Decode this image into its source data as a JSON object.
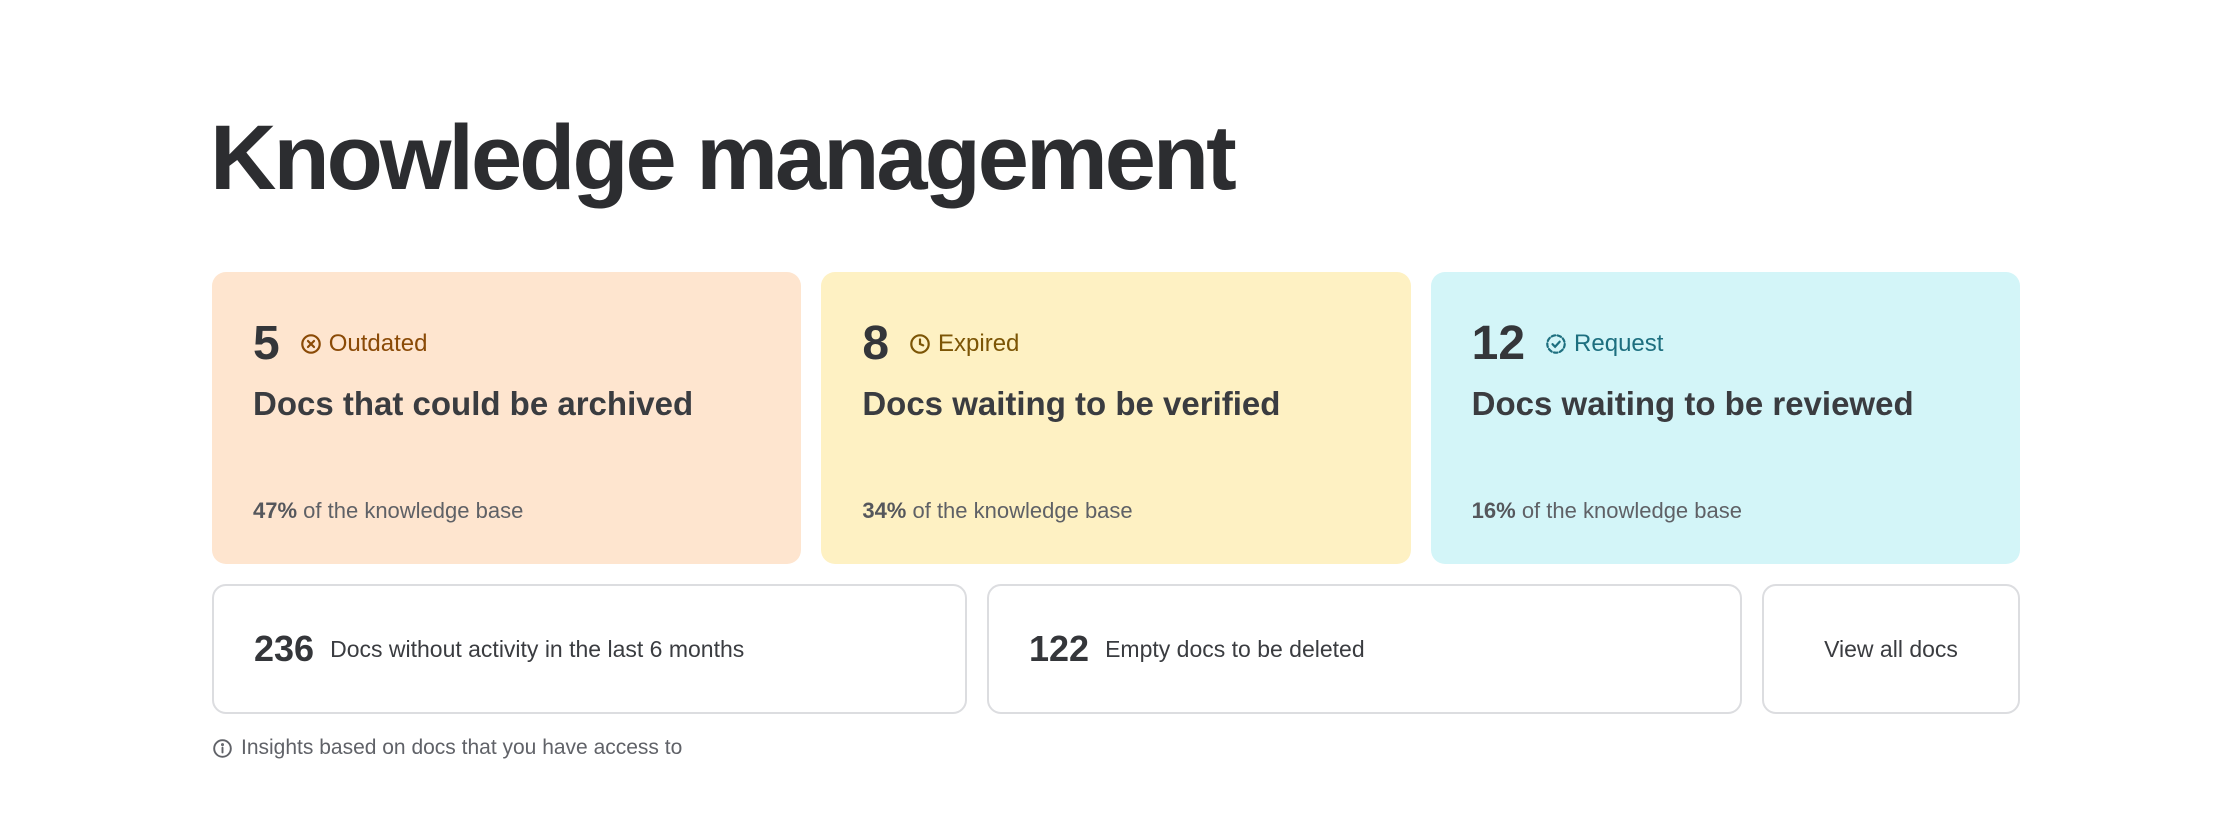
{
  "page": {
    "title": "Knowledge management"
  },
  "stats": [
    {
      "count": "5",
      "status": "Outdated",
      "icon": "x-circle-icon",
      "description": "Docs that could be archived",
      "percent": "47%",
      "percent_suffix": " of the knowledge base",
      "color": "#fee5cf"
    },
    {
      "count": "8",
      "status": "Expired",
      "icon": "clock-icon",
      "description": "Docs waiting to be verified",
      "percent": "34%",
      "percent_suffix": " of the knowledge base",
      "color": "#fef1c3"
    },
    {
      "count": "12",
      "status": "Request",
      "icon": "dashed-check-circle-icon",
      "description": "Docs waiting to be reviewed",
      "percent": "16%",
      "percent_suffix": " of the knowledge base",
      "color": "#d3f5f8"
    }
  ],
  "actions": {
    "inactive": {
      "count": "236",
      "label": "Docs without activity in the last 6 months"
    },
    "empty": {
      "count": "122",
      "label": "Empty docs to be deleted"
    },
    "view_all": {
      "label": "View all docs"
    }
  },
  "footnote": {
    "icon": "info-icon",
    "text": "Insights based on docs that you have access to"
  }
}
